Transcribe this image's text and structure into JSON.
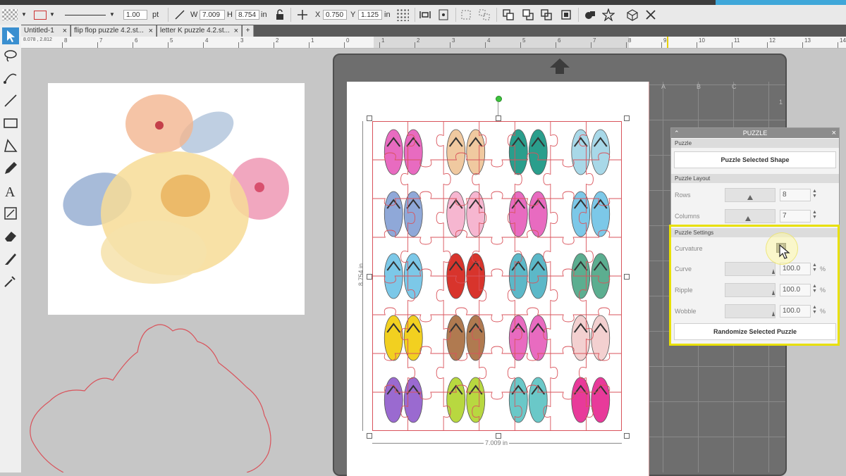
{
  "toolbar": {
    "stroke_width": "1.00",
    "stroke_unit": "pt",
    "w_label": "W",
    "width_value": "7.009",
    "h_label": "H",
    "height_value": "8.754",
    "size_unit": "in",
    "x_label": "X",
    "x_value": "0.750",
    "y_label": "Y",
    "y_value": "1.125",
    "pos_unit": "in"
  },
  "tabs": [
    {
      "label": "Untitled-1"
    },
    {
      "label": "flip flop puzzle 4.2.st..."
    },
    {
      "label": "letter K puzzle 4.2.st..."
    }
  ],
  "tab_add": "+",
  "ruler": {
    "readout": "8.078 , 2.812",
    "labels": [
      "8",
      "7",
      "6",
      "5",
      "4",
      "3",
      "2",
      "1",
      "0",
      "1",
      "2",
      "3",
      "4",
      "5",
      "6",
      "7",
      "8",
      "9",
      "10",
      "11",
      "12",
      "13",
      "14"
    ]
  },
  "canvas": {
    "width_dimension": "7.009 in",
    "height_dimension": "8.754 in",
    "mat_cols": [
      "A",
      "B",
      "C"
    ],
    "mat_row": "1"
  },
  "puzzle_panel": {
    "title": "PUZZLE",
    "close": "×",
    "section_puzzle": "Puzzle",
    "puzzle_selected_shape": "Puzzle Selected Shape",
    "section_layout": "Puzzle Layout",
    "rows_label": "Rows",
    "rows_value": "8",
    "columns_label": "Columns",
    "columns_value": "7",
    "section_settings": "Puzzle Settings",
    "curvature_label": "Curvature",
    "curvature_checked": true,
    "curve_label": "Curve",
    "curve_value": "100.0",
    "ripple_label": "Ripple",
    "ripple_value": "100.0",
    "wobble_label": "Wobble",
    "wobble_value": "100.0",
    "percent_unit": "%",
    "randomize_button": "Randomize Selected Puzzle"
  },
  "flipflop_colors": [
    [
      "#e86bc0",
      "#f0c9a0",
      "#2a9e8c",
      "#a8d8e8"
    ],
    [
      "#8fa8d8",
      "#f6b6d0",
      "#e86bc0",
      "#7cc8e8"
    ],
    [
      "#7cc8e8",
      "#d8342c",
      "#5cb8c8",
      "#5cae90"
    ],
    [
      "#f2d020",
      "#b07a50",
      "#e86bc0",
      "#f3d0d0"
    ],
    [
      "#9a6ad0",
      "#b8d840",
      "#6ac8c8",
      "#e83a9a"
    ]
  ],
  "accent_colors": {
    "highlight": "#e8e000",
    "cut_line": "#d9535b",
    "handle_green": "#3cc43c"
  }
}
